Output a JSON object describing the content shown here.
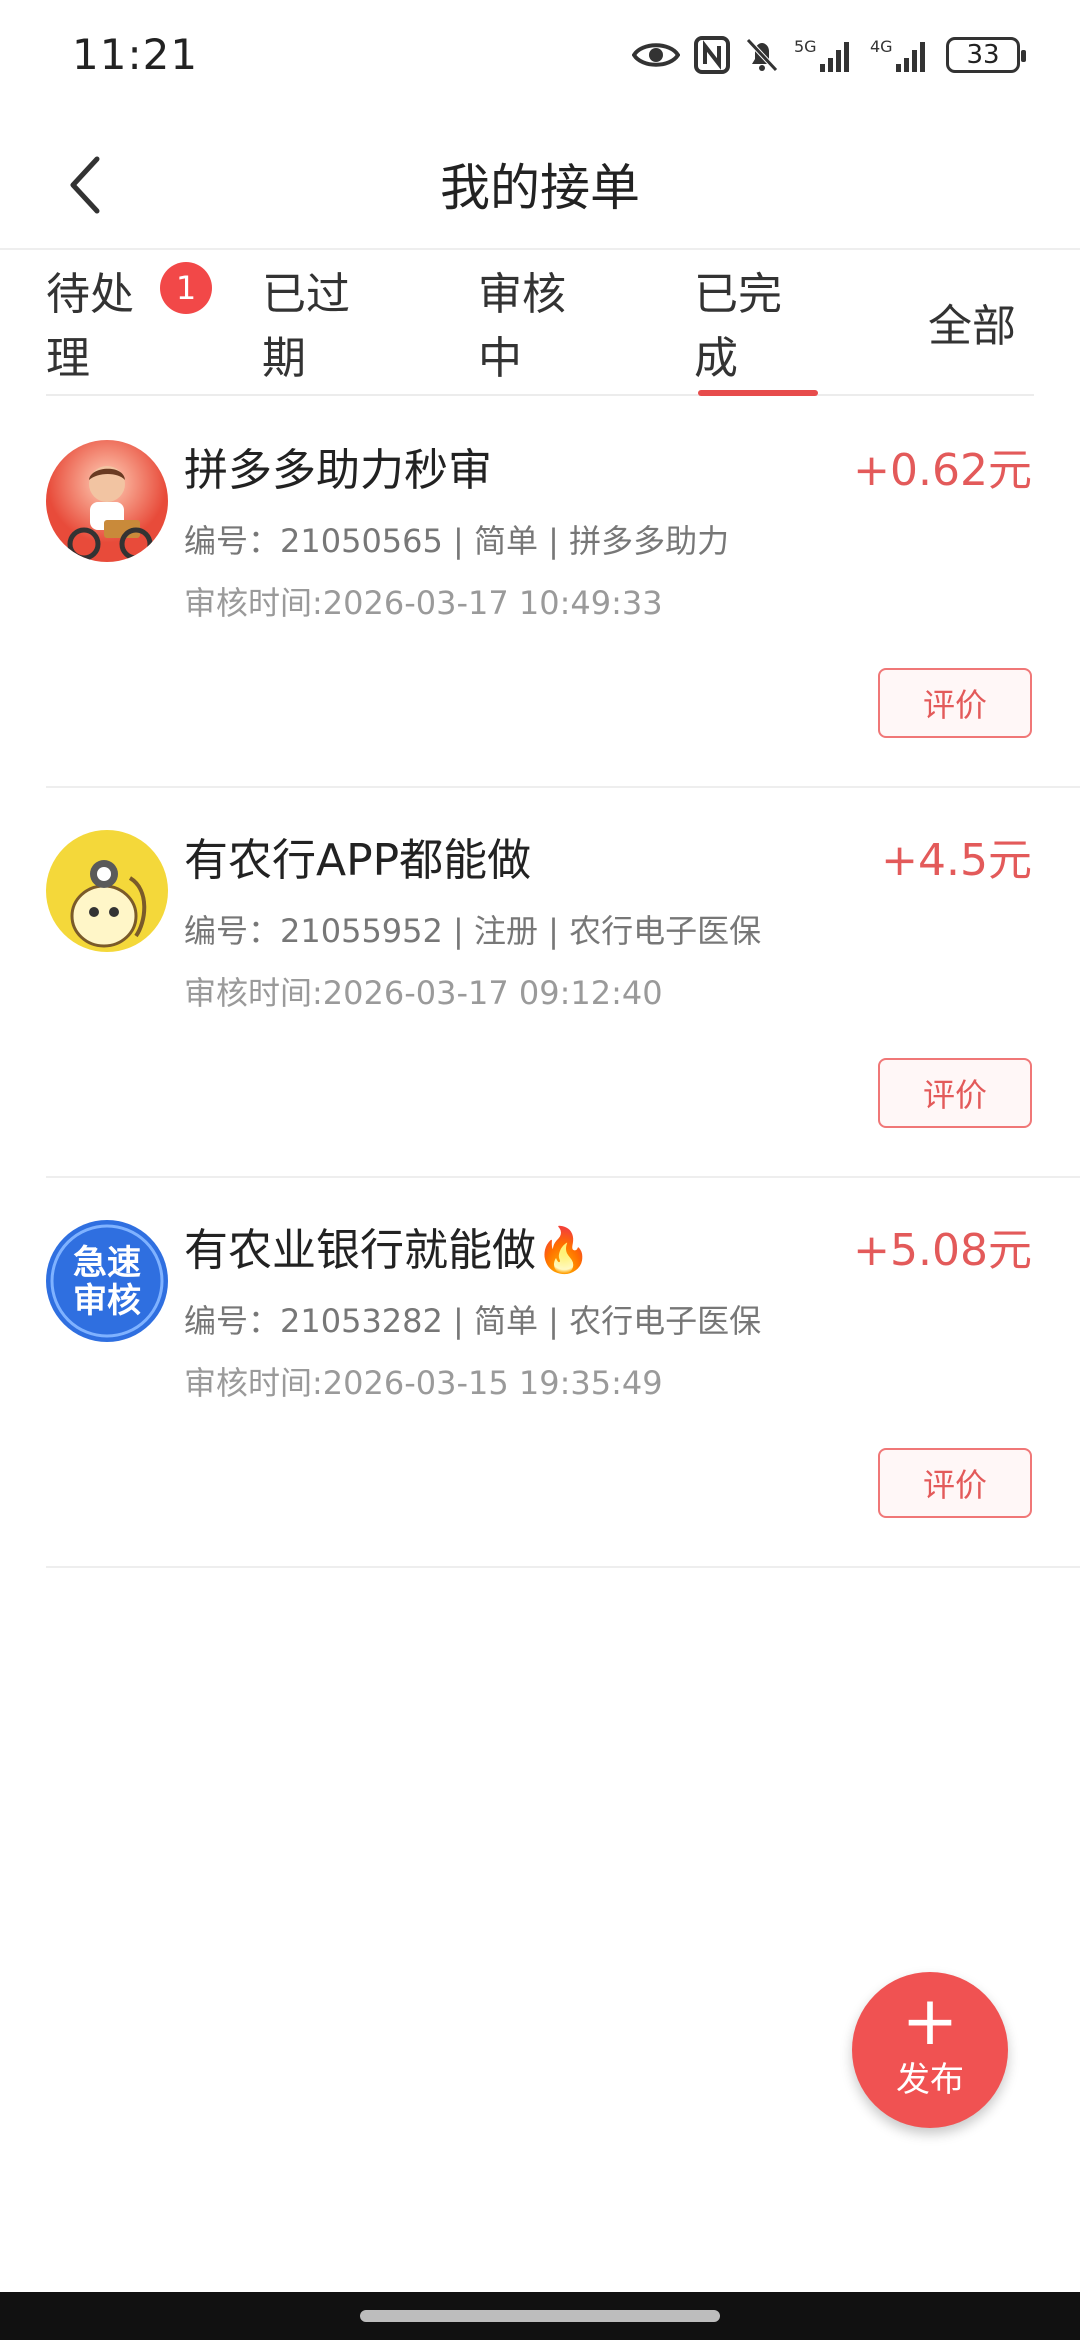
{
  "status_bar": {
    "time": "11:21",
    "battery": "33",
    "icons": [
      "eye-icon",
      "nfc-icon",
      "bell-off-icon",
      "signal-5g-icon",
      "signal-4g-icon",
      "battery-icon"
    ]
  },
  "header": {
    "title": "我的接单",
    "back_icon": "chevron-left-icon"
  },
  "tabs": [
    {
      "label": "待处理",
      "badge": "1"
    },
    {
      "label": "已过期"
    },
    {
      "label": "审核中"
    },
    {
      "label": "已完成",
      "active": true
    },
    {
      "label": "全部"
    }
  ],
  "orders": [
    {
      "title": "拼多多助力秒审",
      "amount": "+0.62元",
      "meta": "编号：21050565 | 简单 | 拼多多助力",
      "time": "审核时间:2026-03-17 10:49:33",
      "button": "评价"
    },
    {
      "title": "有农行APP都能做",
      "amount": "+4.5元",
      "meta": "编号：21055952 | 注册 | 农行电子医保",
      "time": "审核时间:2026-03-17 09:12:40",
      "button": "评价"
    },
    {
      "title": "有农业银行就能做🔥",
      "amount": "+5.08元",
      "meta": "编号：21053282 | 简单 | 农行电子医保",
      "time": "审核时间:2026-03-15 19:35:49",
      "button": "评价",
      "avatar_text": "急速审核"
    }
  ],
  "fab": {
    "icon": "+",
    "label": "发布"
  },
  "colors": {
    "accent": "#e74c4c",
    "amount": "#e35a5a",
    "badge": "#f24848"
  }
}
